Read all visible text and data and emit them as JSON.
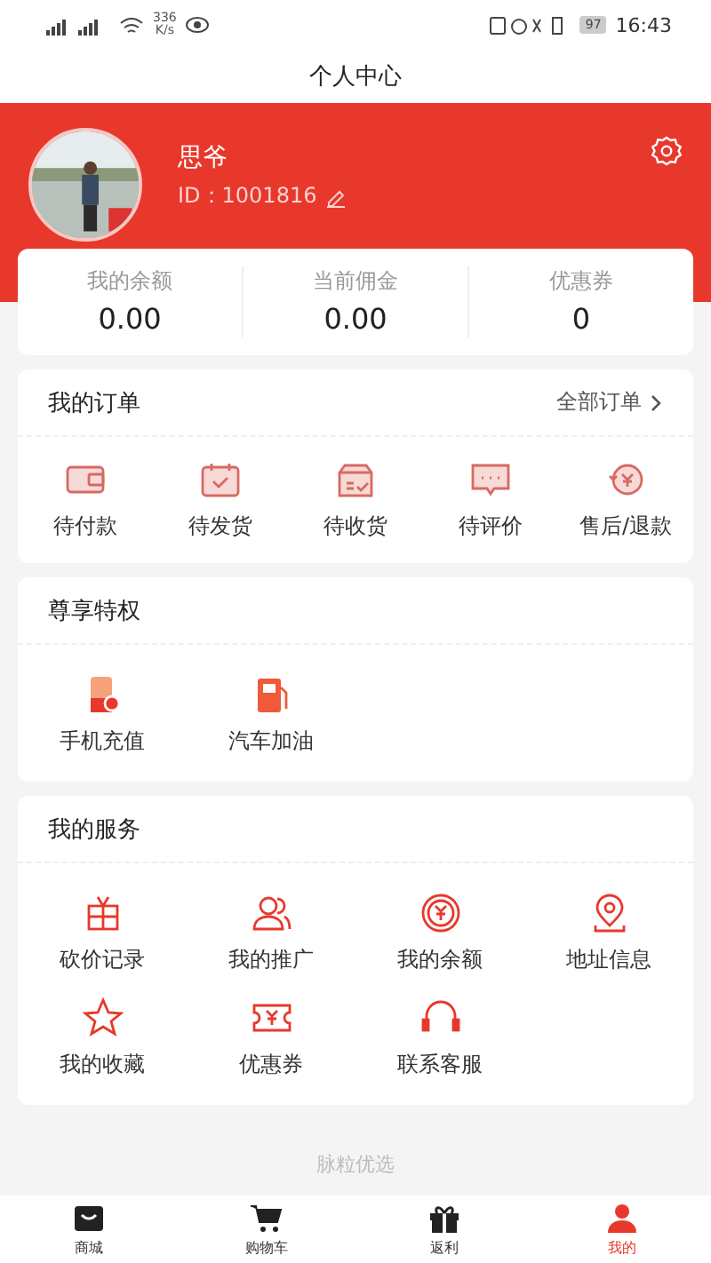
{
  "status_bar": {
    "speed": "336",
    "speed_unit": "K/s",
    "battery": "97",
    "time": "16:43"
  },
  "header": {
    "title": "个人中心"
  },
  "profile": {
    "name": "思爷",
    "id": "ID：1001816"
  },
  "stats": [
    {
      "label": "我的余额",
      "value": "0.00"
    },
    {
      "label": "当前佣金",
      "value": "0.00"
    },
    {
      "label": "优惠券",
      "value": "0"
    }
  ],
  "orders": {
    "title": "我的订单",
    "link": "全部订单",
    "items": [
      {
        "kind": "wallet",
        "label": "待付款"
      },
      {
        "kind": "calendar",
        "label": "待发货"
      },
      {
        "kind": "box",
        "label": "待收货"
      },
      {
        "kind": "chat",
        "label": "待评价"
      },
      {
        "kind": "refund",
        "label": "售后/退款"
      }
    ]
  },
  "privileges": {
    "title": "尊享特权",
    "items": [
      {
        "kind": "phone",
        "label": "手机充值"
      },
      {
        "kind": "fuel",
        "label": "汽车加油"
      }
    ]
  },
  "services": {
    "title": "我的服务",
    "items": [
      {
        "kind": "gift",
        "label": "砍价记录"
      },
      {
        "kind": "people",
        "label": "我的推广"
      },
      {
        "kind": "coin",
        "label": "我的余额"
      },
      {
        "kind": "location",
        "label": "地址信息"
      },
      {
        "kind": "star",
        "label": "我的收藏"
      },
      {
        "kind": "ticket",
        "label": "优惠券"
      },
      {
        "kind": "headset",
        "label": "联系客服"
      }
    ]
  },
  "footer": "脉粒优选",
  "tabs": [
    {
      "kind": "bag",
      "label": "商城",
      "selected": false
    },
    {
      "kind": "cart",
      "label": "购物车",
      "selected": false
    },
    {
      "kind": "gift",
      "label": "返利",
      "selected": false
    },
    {
      "kind": "person",
      "label": "我的",
      "selected": true
    }
  ]
}
